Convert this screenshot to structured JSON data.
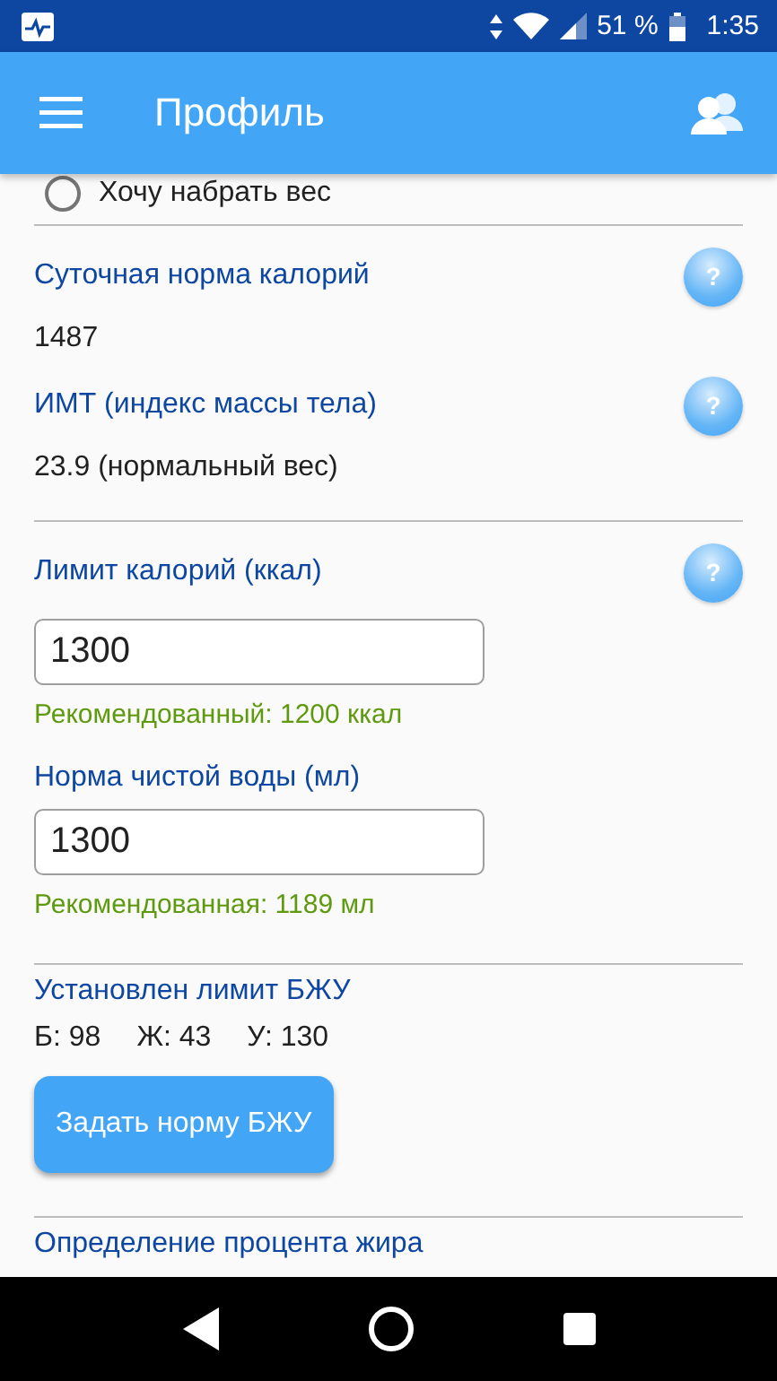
{
  "status_bar": {
    "battery_percent": "51 %",
    "time": "1:35"
  },
  "app_bar": {
    "title": "Профиль"
  },
  "radio": {
    "label": "Хочу набрать вес",
    "selected": false
  },
  "sections": [
    {
      "kind": "info",
      "rows": [
        {
          "label": "Суточная норма калорий",
          "help": "?",
          "value": "1487"
        },
        {
          "label": "ИМТ (индекс массы тела)",
          "help": "?",
          "value": "23.9 (нормальный вес)"
        }
      ]
    },
    {
      "kind": "inputs",
      "help_label": "Лимит калорий (ккал)",
      "help": "?",
      "rows": [
        {
          "value": "1300",
          "hint": "Рекомендованный: 1200 ккал"
        },
        {
          "label": "Норма чистой воды (мл)",
          "value": "1300",
          "hint": "Рекомендованная: 1189 мл"
        }
      ]
    },
    {
      "kind": "macros",
      "label": "Установлен лимит БЖУ",
      "values": [
        "Б: 98",
        "Ж: 43",
        "У: 130"
      ],
      "button": "Задать норму БЖУ"
    },
    {
      "kind": "heading",
      "label": "Определение процента жира"
    }
  ]
}
